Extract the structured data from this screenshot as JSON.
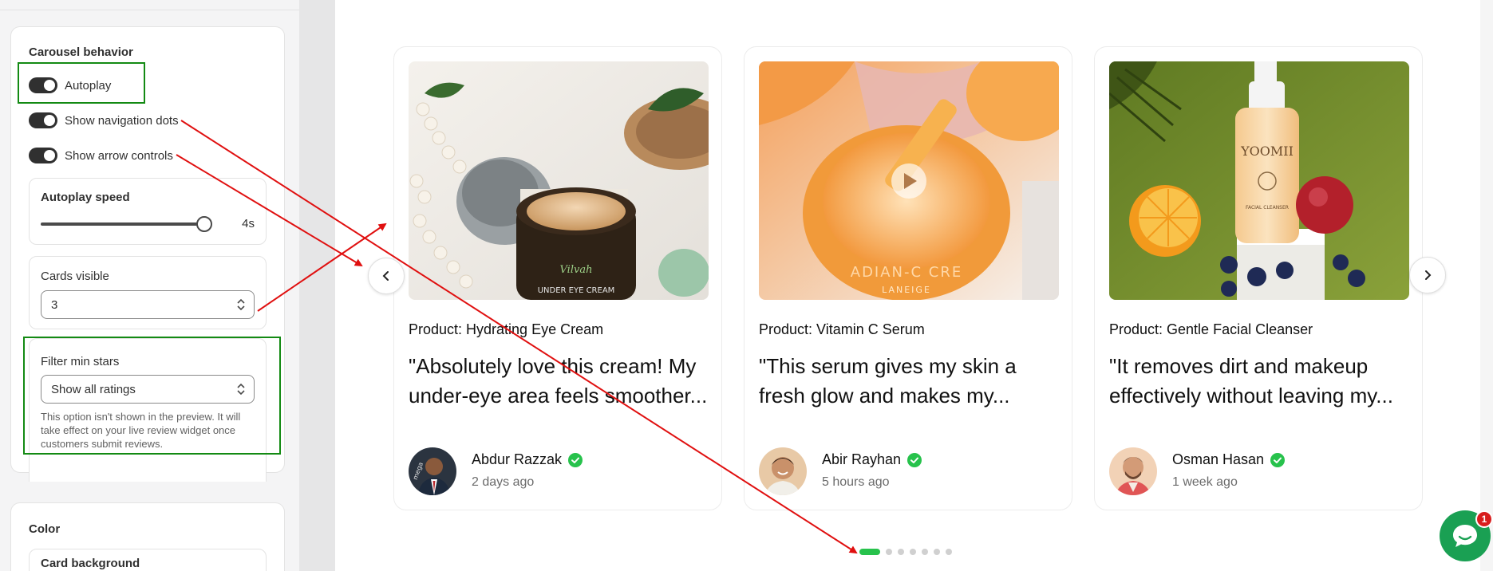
{
  "settings": {
    "carousel_behavior": {
      "title": "Carousel behavior",
      "autoplay_label": "Autoplay",
      "nav_dots_label": "Show navigation dots",
      "arrow_controls_label": "Show arrow controls",
      "autoplay_speed_label": "Autoplay speed",
      "autoplay_speed_value": "4s",
      "autoplay_speed_fraction": 0.85,
      "cards_visible_label": "Cards visible",
      "cards_visible_value": "3",
      "filter_label": "Filter min stars",
      "filter_value": "Show all ratings",
      "filter_help": "This option isn't shown in the preview. It will take effect on your live review widget once customers submit reviews."
    },
    "color": {
      "title": "Color",
      "card_background_label": "Card background"
    }
  },
  "preview": {
    "reviews": [
      {
        "product": "Product: Hydrating Eye Cream",
        "quote": "\"Absolutely love this cream! My under-eye area feels smoother...",
        "name": "Abdur Razzak",
        "time": "2 days ago"
      },
      {
        "product": "Product: Vitamin C Serum",
        "quote": "\"This serum gives my skin a fresh glow and makes my...",
        "name": "Abir Rayhan",
        "time": "5 hours ago"
      },
      {
        "product": "Product: Gentle Facial Cleanser",
        "quote": "\"It removes dirt and makeup effectively without leaving my...",
        "name": "Osman Hasan",
        "time": "1 week ago"
      }
    ],
    "dots_total": 7,
    "dots_active_index": 0,
    "chat_badge": "1"
  },
  "colors": {
    "accent_green": "#27c24c",
    "highlight_box": "#138a13",
    "annotation_arrow": "#e01010",
    "chat_green": "#1aa053",
    "badge_red": "#d81e1e"
  }
}
